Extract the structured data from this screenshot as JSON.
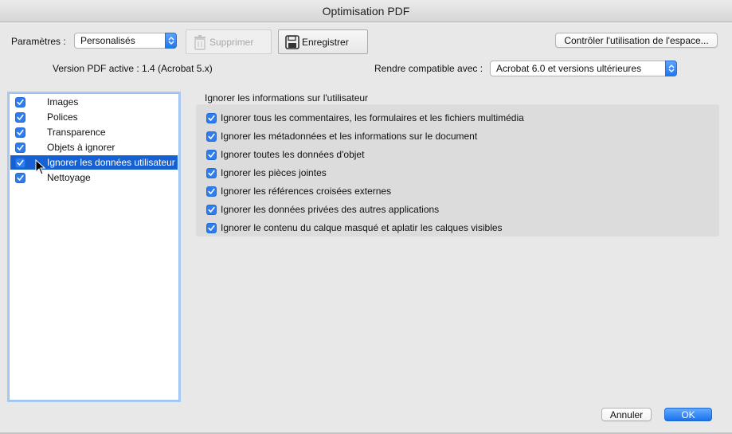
{
  "window": {
    "title": "Optimisation PDF"
  },
  "toolbar": {
    "parametres_label": "Paramètres :",
    "preset_value": "Personalisés",
    "delete_label": "Supprimer",
    "save_label": "Enregistrer",
    "audit_label": "Contrôler l'utilisation de l'espace..."
  },
  "version_line": {
    "version_text": "Version PDF active : 1.4 (Acrobat 5.x)",
    "compat_label": "Rendre compatible avec :",
    "compat_value": "Acrobat 6.0 et versions ultérieures"
  },
  "sidebar": {
    "items": [
      {
        "label": "Images",
        "checked": true,
        "selected": false
      },
      {
        "label": "Polices",
        "checked": true,
        "selected": false
      },
      {
        "label": "Transparence",
        "checked": true,
        "selected": false
      },
      {
        "label": "Objets à ignorer",
        "checked": true,
        "selected": false
      },
      {
        "label": "Ignorer les données utilisateur",
        "checked": true,
        "selected": true
      },
      {
        "label": "Nettoyage",
        "checked": true,
        "selected": false
      }
    ]
  },
  "main": {
    "section_title": "Ignorer les informations sur l'utilisateur",
    "options": [
      {
        "label": "Ignorer tous les commentaires, les formulaires et les fichiers multimédia",
        "checked": true
      },
      {
        "label": "Ignorer les métadonnées et les informations sur le document",
        "checked": true
      },
      {
        "label": "Ignorer toutes les données d'objet",
        "checked": true
      },
      {
        "label": "Ignorer les pièces jointes",
        "checked": true
      },
      {
        "label": "Ignorer les références croisées externes",
        "checked": true
      },
      {
        "label": "Ignorer les données privées des autres applications",
        "checked": true
      },
      {
        "label": "Ignorer le contenu du calque masqué et aplatir les calques visibles",
        "checked": true
      }
    ]
  },
  "footer": {
    "cancel_label": "Annuler",
    "ok_label": "OK"
  },
  "colors": {
    "accent": "#2d7cf0",
    "selection": "#1561d3",
    "panel": "#dcdcdc"
  }
}
